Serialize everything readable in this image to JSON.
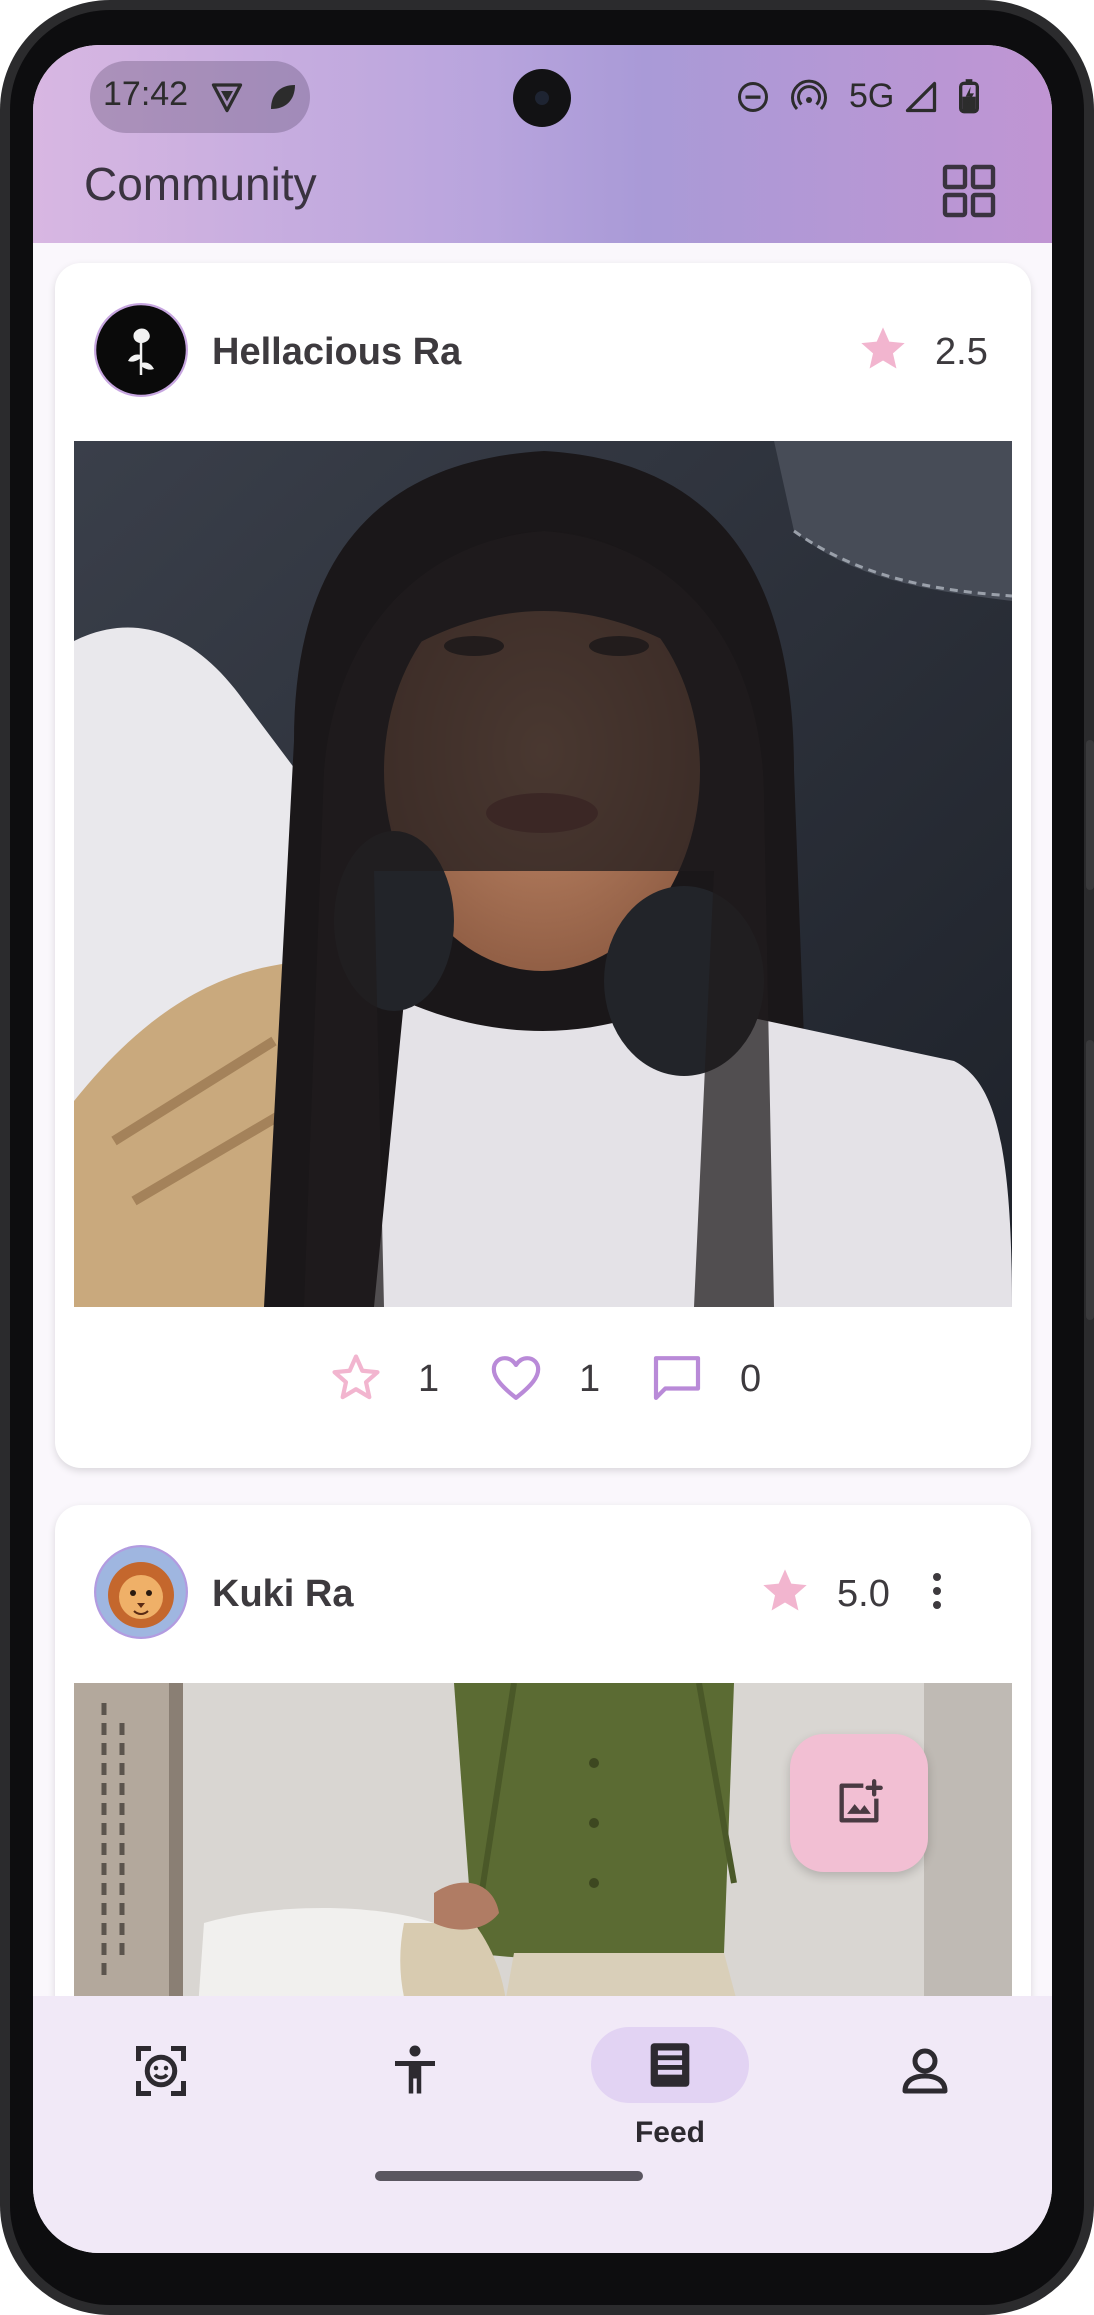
{
  "status_bar": {
    "time": "17:42",
    "network": "5G",
    "icons": [
      "vpn-shield-icon",
      "leaf-notification-icon",
      "dnd-icon",
      "hotspot-icon",
      "signal-icon",
      "battery-charging-icon"
    ]
  },
  "app_bar": {
    "title": "Community",
    "action_icon": "grid-view-icon"
  },
  "posts": [
    {
      "author": "Hellacious Ra",
      "avatar_icon": "white-rose-avatar",
      "rating": "2.5",
      "counts": {
        "stars": "1",
        "likes": "1",
        "comments": "0"
      }
    },
    {
      "author": "Kuki Ra",
      "avatar_icon": "lion-avatar",
      "rating": "5.0",
      "menu_icon": "more-vert-icon"
    }
  ],
  "fab": {
    "icon": "add-photo-icon"
  },
  "bottom_nav": {
    "items": [
      {
        "icon": "face-scan-icon",
        "label": ""
      },
      {
        "icon": "accessibility-icon",
        "label": ""
      },
      {
        "icon": "feed-icon",
        "label": "Feed",
        "selected": true
      },
      {
        "icon": "person-icon",
        "label": ""
      }
    ]
  },
  "colors": {
    "accent_pink": "#f2b5cf",
    "accent_purple": "#b98ad8",
    "nav_bg": "#f1e9f7",
    "nav_pill": "#e2d3f3"
  }
}
